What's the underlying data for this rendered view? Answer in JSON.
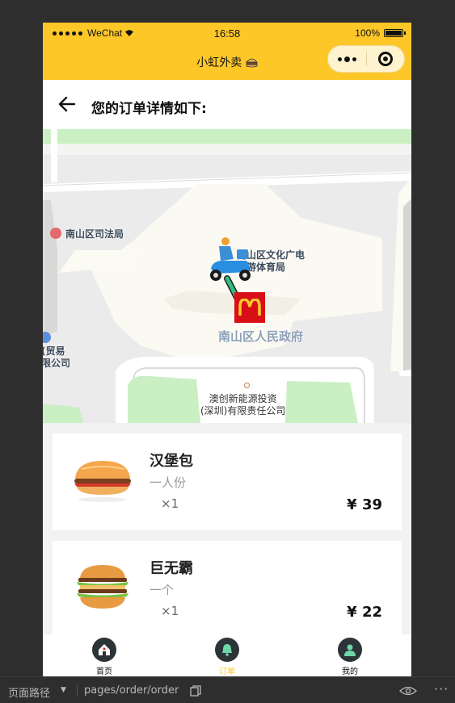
{
  "status_bar": {
    "carrier": "WeChat",
    "time": "16:58",
    "battery": "100%"
  },
  "nav": {
    "title": "小虹外卖"
  },
  "header": {
    "title": "您的订单详情如下:"
  },
  "map": {
    "pois": {
      "court": "南山区司法局",
      "culture_line1": "南山区文化广电",
      "culture_line2": "游体育局",
      "gov": "南山区人民政府",
      "trade_line1": "(贸易",
      "trade_line2": "限公司",
      "energy_line1": "澳创新能源投资",
      "energy_line2": "(深圳)有限责任公司"
    }
  },
  "orders": [
    {
      "name": "汉堡包",
      "desc": "一人份",
      "qty": "×1",
      "price": "¥ 39"
    },
    {
      "name": "巨无霸",
      "desc": "一个",
      "qty": "×1",
      "price": "¥ 22"
    }
  ],
  "tabs": [
    {
      "label": "首页",
      "icon": "home-icon"
    },
    {
      "label": "订单",
      "icon": "bell-icon"
    },
    {
      "label": "我的",
      "icon": "user-icon"
    }
  ],
  "colors": {
    "brand": "#fdc728",
    "mcd_red": "#d80f17",
    "route_green": "#2fbf7a"
  },
  "devtools": {
    "route_label": "页面路径",
    "path": "pages/order/order"
  }
}
